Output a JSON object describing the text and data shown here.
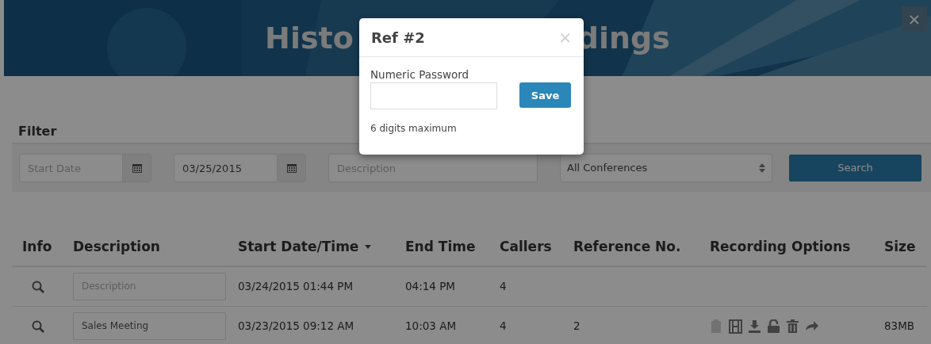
{
  "header": {
    "title_fragments": [
      "Histo",
      "dings"
    ],
    "close_button": "×"
  },
  "filter": {
    "label": "Filter",
    "fields": [
      {
        "kind": "date",
        "placeholder": "Start Date"
      },
      {
        "kind": "date",
        "value": "03/25/2015"
      },
      {
        "kind": "text",
        "placeholder": "Description"
      },
      {
        "kind": "select",
        "value": "All Conferences"
      }
    ],
    "search_button": "Search"
  },
  "table": {
    "columns": [
      {
        "label": "Info",
        "sorted": false
      },
      {
        "label": "Description",
        "sorted": false
      },
      {
        "label": "Start Date/Time",
        "sorted": true
      },
      {
        "label": "End Time",
        "sorted": false
      },
      {
        "label": "Callers",
        "sorted": false
      },
      {
        "label": "Reference No.",
        "sorted": false
      },
      {
        "label": "Recording Options",
        "sorted": false
      },
      {
        "label": "Size",
        "sorted": false
      }
    ],
    "rows": [
      {
        "description": {
          "placeholder": "Description"
        },
        "start": "03/24/2015 01:44 PM",
        "end": "04:14 PM",
        "callers": "4"
      },
      {
        "description": {
          "value": "Sales Meeting"
        },
        "start": "03/23/2015 09:12 AM",
        "end": "10:03 AM",
        "callers": "4",
        "reference": "2",
        "recording_options": [
          {
            "kind": "transcript",
            "disabled": true
          },
          {
            "kind": "video",
            "disabled": false
          },
          {
            "kind": "download",
            "disabled": false
          },
          {
            "kind": "lock",
            "disabled": false
          },
          {
            "kind": "delete",
            "disabled": false
          },
          {
            "kind": "forward",
            "disabled": false
          }
        ],
        "size": "83MB"
      }
    ]
  },
  "modal": {
    "title": "Ref #2",
    "close": "×",
    "field_label": "Numeric Password",
    "save_button": "Save",
    "help": "6 digits maximum"
  }
}
